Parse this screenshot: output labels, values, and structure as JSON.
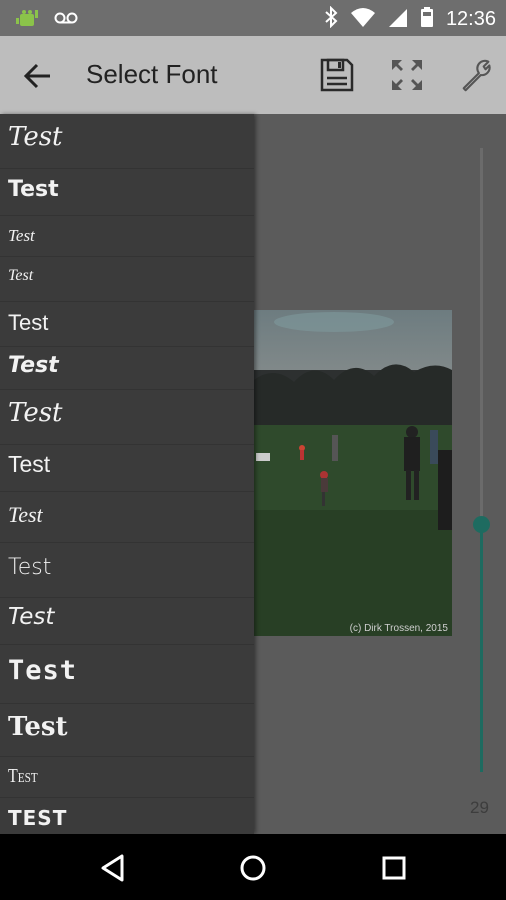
{
  "status_bar": {
    "time": "12:36",
    "icons": [
      "android-notification-icon",
      "voicemail-icon",
      "bluetooth-icon",
      "wifi-icon",
      "signal-icon",
      "battery-icon"
    ]
  },
  "app_bar": {
    "title": "Select Font",
    "actions": [
      "save-icon",
      "fullscreen-icon",
      "wrench-icon"
    ]
  },
  "font_list": {
    "items": [
      {
        "label": "Test",
        "style": "script-italic"
      },
      {
        "label": "Test",
        "style": "sans-bold"
      },
      {
        "label": "Test",
        "style": "script-small"
      },
      {
        "label": "Test",
        "style": "script-small-2"
      },
      {
        "label": "Test",
        "style": "sans"
      },
      {
        "label": "Test",
        "style": "handwritten-bold"
      },
      {
        "label": "Test",
        "style": "calligraphy"
      },
      {
        "label": "Test",
        "style": "sans-2"
      },
      {
        "label": "Test",
        "style": "script-light"
      },
      {
        "label": "Test",
        "style": "sans-light"
      },
      {
        "label": "Test",
        "style": "marker"
      },
      {
        "label": "Test",
        "style": "rounded-bold"
      },
      {
        "label": "Test",
        "style": "serif-bold"
      },
      {
        "label": "Test",
        "style": "condensed-smallcaps"
      },
      {
        "label": "TEST",
        "style": "heavy-caps"
      }
    ]
  },
  "canvas": {
    "photo_credit": "(c) Dirk Trossen, 2015",
    "slider_value": "29",
    "slider_level": 0.4
  },
  "colors": {
    "accent": "#1e6b60",
    "app_bar": "#bdbdbd",
    "drawer": "#3b3b3b"
  }
}
